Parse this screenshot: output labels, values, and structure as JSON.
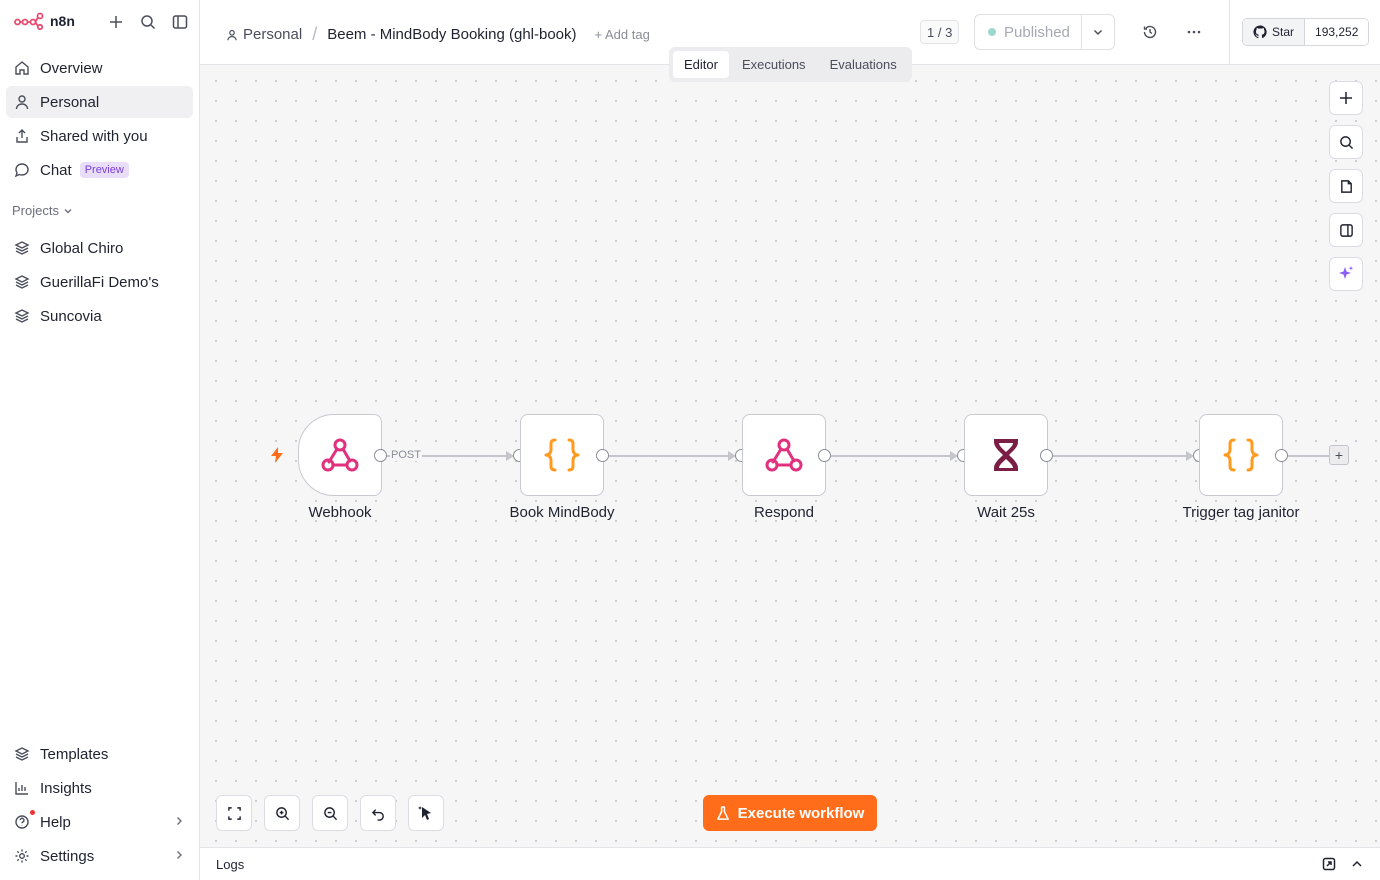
{
  "app": {
    "name": "n8n",
    "accent": "#ff6d1a",
    "brand": "#ea4b71"
  },
  "sidebar": {
    "nav": [
      {
        "label": "Overview",
        "icon": "home-icon"
      },
      {
        "label": "Personal",
        "icon": "user-icon",
        "active": true
      },
      {
        "label": "Shared with you",
        "icon": "share-icon"
      },
      {
        "label": "Chat",
        "icon": "chat-icon",
        "badge": "Preview"
      }
    ],
    "projects_label": "Projects",
    "projects": [
      {
        "label": "Global Chiro",
        "icon": "layers-icon"
      },
      {
        "label": "GuerillaFi Demo's",
        "icon": "layers-icon"
      },
      {
        "label": "Suncovia",
        "icon": "layers-icon"
      }
    ],
    "bottom": [
      {
        "label": "Templates",
        "icon": "templates-icon"
      },
      {
        "label": "Insights",
        "icon": "chart-icon"
      },
      {
        "label": "Help",
        "icon": "help-icon",
        "chevron": true
      },
      {
        "label": "Settings",
        "icon": "gear-icon",
        "chevron": true
      }
    ]
  },
  "header": {
    "breadcrumb_project": "Personal",
    "workflow_name": "Beem - MindBody Booking (ghl-book)",
    "add_tag": "+ Add tag",
    "version": "1 / 3",
    "status": "Published",
    "github_star": "Star",
    "github_count": "193,252"
  },
  "tabs": [
    {
      "label": "Editor",
      "active": true
    },
    {
      "label": "Executions"
    },
    {
      "label": "Evaluations"
    }
  ],
  "workflow": {
    "nodes": [
      {
        "label": "Webhook",
        "icon": "webhook-icon"
      },
      {
        "label": "Book MindBody",
        "icon": "code-braces-icon"
      },
      {
        "label": "Respond",
        "icon": "webhook-icon"
      },
      {
        "label": "Wait 25s",
        "icon": "hourglass-icon"
      },
      {
        "label": "Trigger tag janitor",
        "icon": "code-braces-icon"
      }
    ],
    "first_connection_label": "POST"
  },
  "execute_label": "Execute workflow",
  "logs_label": "Logs"
}
